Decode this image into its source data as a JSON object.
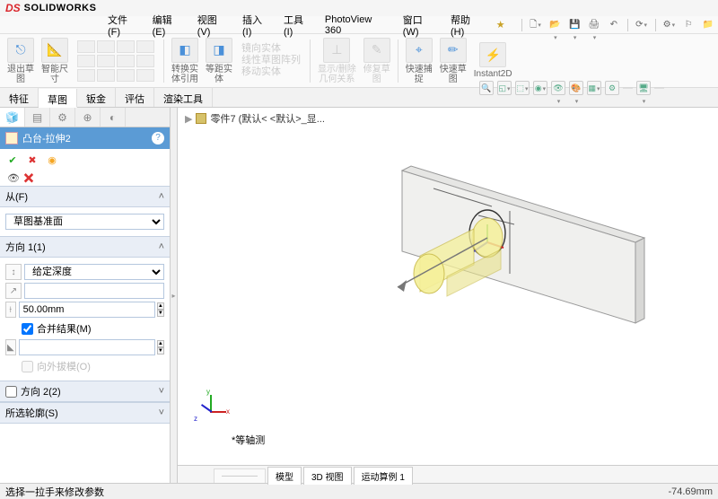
{
  "app": {
    "brand": "SOLIDWORKS"
  },
  "menu": {
    "file": "文件(F)",
    "edit": "编辑(E)",
    "view": "视图(V)",
    "insert": "插入(I)",
    "tools": "工具(I)",
    "photoview": "PhotoView 360",
    "window": "窗口(W)",
    "help": "帮助(H)",
    "star": "★"
  },
  "ribbon": {
    "exit_sketch": "退出草\n图",
    "smart_dim": "智能尺\n寸",
    "rev_body": "转换实\n体引用",
    "eq_body": "等距实\n体",
    "mirror": "镜向实体",
    "linpat": "线性草图阵列",
    "move": "移动实体",
    "disp_del": "显示/删除\n几何关系",
    "repair": "修复草\n图",
    "quick_snap": "快速捕\n捉",
    "quick_sketch": "快速草\n图",
    "instant": "Instant2D"
  },
  "cmdtabs": {
    "feature": "特征",
    "sketch": "草图",
    "sheetmetal": "钣金",
    "evaluate": "评估",
    "render": "渲染工具"
  },
  "fm": {
    "title": "凸台-拉伸2",
    "from": "从(F)",
    "from_value": "草图基准面",
    "dir1": "方向 1(1)",
    "end_cond": "给定深度",
    "depth_value": "",
    "dist_value": "50.00mm",
    "merge": "合并结果(M)",
    "draft_value": "",
    "outward": "向外拔模(O)",
    "dir2": "方向 2(2)",
    "sel_contour": "所选轮廓(S)"
  },
  "breadcrumb": {
    "part": "零件7  (默认< <默认>_显..."
  },
  "viewlabel": "*等轴测",
  "viewtabs": {
    "ghost": "————",
    "model": "模型",
    "view3d": "3D 视图",
    "motion": "运动算例 1"
  },
  "status": {
    "msg": "选择一拉手来修改参数",
    "coord": "-74.69mm"
  }
}
